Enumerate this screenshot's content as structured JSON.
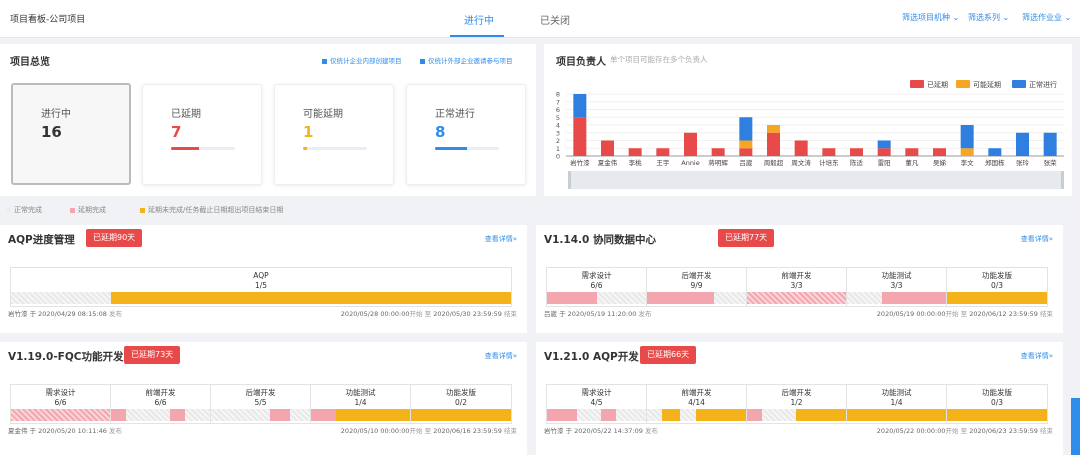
{
  "header": {
    "title": "项目看板-公司项目",
    "tabs": [
      "进行中",
      "已关闭"
    ],
    "filters": [
      "筛选项目机种 ⌄",
      "筛选系列 ⌄",
      "筛选作业业 ⌄"
    ]
  },
  "overview": {
    "title": "项目总览",
    "legend": [
      "仅统计企业内部创建项目",
      "仅统计外部企业邀请参与项目"
    ],
    "cards": [
      {
        "label": "进行中",
        "value": "16",
        "color": "#333333",
        "progress": null
      },
      {
        "label": "已延期",
        "value": "7",
        "color": "#e84a4a",
        "progress": 0.44
      },
      {
        "label": "可能延期",
        "value": "1",
        "color": "#f5b31b",
        "progress": 0.06
      },
      {
        "label": "正常进行",
        "value": "8",
        "color": "#2f8ceb",
        "progress": 0.5
      }
    ]
  },
  "owners": {
    "title": "项目负责人",
    "subtitle": "单个项目可能存在多个负责人"
  },
  "chart_data": {
    "type": "bar",
    "stacked": true,
    "categories": [
      "岩竹漆",
      "夏金伟",
      "李桃",
      "王宇",
      "Annie",
      "蒋明辉",
      "吕崴",
      "周毅超",
      "周文涛",
      "计培东",
      "陈适",
      "雷阳",
      "董凡",
      "吴娣",
      "李文",
      "郑国栋",
      "张玲",
      "张荣"
    ],
    "series": [
      {
        "name": "已延期",
        "color": "#e84a4a",
        "values": [
          5,
          2,
          1,
          1,
          3,
          1,
          1,
          3,
          2,
          1,
          1,
          1,
          1,
          1,
          0,
          0,
          0,
          0
        ]
      },
      {
        "name": "可能延期",
        "color": "#f5a623",
        "values": [
          0,
          0,
          0,
          0,
          0,
          0,
          1,
          1,
          0,
          0,
          0,
          0,
          0,
          0,
          1,
          0,
          0,
          0
        ]
      },
      {
        "name": "正常进行",
        "color": "#2f7fe0",
        "values": [
          3,
          0,
          0,
          0,
          0,
          0,
          3,
          0,
          0,
          0,
          0,
          1,
          0,
          0,
          3,
          1,
          3,
          3
        ]
      }
    ],
    "yticks": [
      "0",
      "1",
      "2",
      "3",
      "4",
      "5",
      "6",
      "7",
      "8"
    ],
    "ylim": [
      0,
      8
    ],
    "legend_position": "top-right"
  },
  "global_legend": [
    "正常完成",
    "延期完成",
    "延期未完成/任务截止日期超出项目结束日期"
  ],
  "projects": [
    {
      "name": "AQP进度管理",
      "badge": "已延期90天",
      "more": "查看详情»",
      "creator": "岩竹漆 于 2020/04/29 08:15:08",
      "created_suffix": "发布",
      "start": "2020/05/28 00:00:00",
      "start_suffix": "开始 至",
      "end": "2020/05/30 23:59:59",
      "end_suffix": "结束",
      "phases": [
        {
          "name": "AQP",
          "count": "1/5",
          "segments": [
            [
              "h",
              20
            ],
            [
              "y",
              80
            ]
          ]
        }
      ]
    },
    {
      "name": "V1.14.0 协同数据中心",
      "badge": "已延期77天",
      "more": "查看详情»",
      "creator": "吕崴 于 2020/05/19 11:20:00",
      "created_suffix": "发布",
      "start": "2020/05/19 00:00:00",
      "start_suffix": "开始 至",
      "end": "2020/06/12 23:59:59",
      "end_suffix": "结束",
      "phases": [
        {
          "name": "需求设计",
          "count": "6/6",
          "segments": [
            [
              "r",
              50
            ],
            [
              "h",
              50
            ]
          ]
        },
        {
          "name": "后端开发",
          "count": "9/9",
          "segments": [
            [
              "r",
              68
            ],
            [
              "h",
              32
            ]
          ]
        },
        {
          "name": "前端开发",
          "count": "3/3",
          "segments": [
            [
              "rh",
              100
            ]
          ]
        },
        {
          "name": "功能测试",
          "count": "3/3",
          "segments": [
            [
              "h",
              35
            ],
            [
              "r",
              65
            ]
          ]
        },
        {
          "name": "功能发版",
          "count": "0/3",
          "segments": [
            [
              "y",
              100
            ]
          ]
        }
      ]
    },
    {
      "name": "V1.19.0-FQC功能开发",
      "badge": "已延期73天",
      "more": "查看详情»",
      "creator": "夏金伟 于 2020/05/20 10:11:46",
      "created_suffix": "发布",
      "start": "2020/05/10 00:00:00",
      "start_suffix": "开始 至",
      "end": "2020/06/16 23:59:59",
      "end_suffix": "结束",
      "phases": [
        {
          "name": "需求设计",
          "count": "6/6",
          "segments": [
            [
              "rh",
              100
            ]
          ]
        },
        {
          "name": "前端开发",
          "count": "6/6",
          "segments": [
            [
              "r",
              15
            ],
            [
              "h",
              45
            ],
            [
              "r",
              15
            ],
            [
              "h",
              25
            ]
          ]
        },
        {
          "name": "后端开发",
          "count": "5/5",
          "segments": [
            [
              "h",
              60
            ],
            [
              "r",
              20
            ],
            [
              "h",
              20
            ]
          ]
        },
        {
          "name": "功能测试",
          "count": "1/4",
          "segments": [
            [
              "r",
              25
            ],
            [
              "y",
              75
            ]
          ]
        },
        {
          "name": "功能发版",
          "count": "0/2",
          "segments": [
            [
              "y",
              100
            ]
          ]
        }
      ]
    },
    {
      "name": "V1.21.0 AQP开发",
      "badge": "已延期66天",
      "more": "查看详情»",
      "creator": "岩竹漆 于 2020/05/22 14:37:09",
      "created_suffix": "发布",
      "start": "2020/05/22 00:00:00",
      "start_suffix": "开始 至",
      "end": "2020/06/23 23:59:59",
      "end_suffix": "结束",
      "phases": [
        {
          "name": "需求设计",
          "count": "4/5",
          "segments": [
            [
              "r",
              30
            ],
            [
              "h",
              25
            ],
            [
              "r",
              15
            ],
            [
              "h",
              30
            ]
          ]
        },
        {
          "name": "前端开发",
          "count": "4/14",
          "segments": [
            [
              "h",
              15
            ],
            [
              "y",
              18
            ],
            [
              "h",
              17
            ],
            [
              "y",
              50
            ]
          ]
        },
        {
          "name": "后端开发",
          "count": "1/2",
          "segments": [
            [
              "r",
              15
            ],
            [
              "h",
              35
            ],
            [
              "y",
              50
            ]
          ]
        },
        {
          "name": "功能测试",
          "count": "1/4",
          "segments": [
            [
              "y",
              100
            ]
          ]
        },
        {
          "name": "功能发版",
          "count": "0/3",
          "segments": [
            [
              "y",
              100
            ]
          ]
        }
      ]
    }
  ]
}
